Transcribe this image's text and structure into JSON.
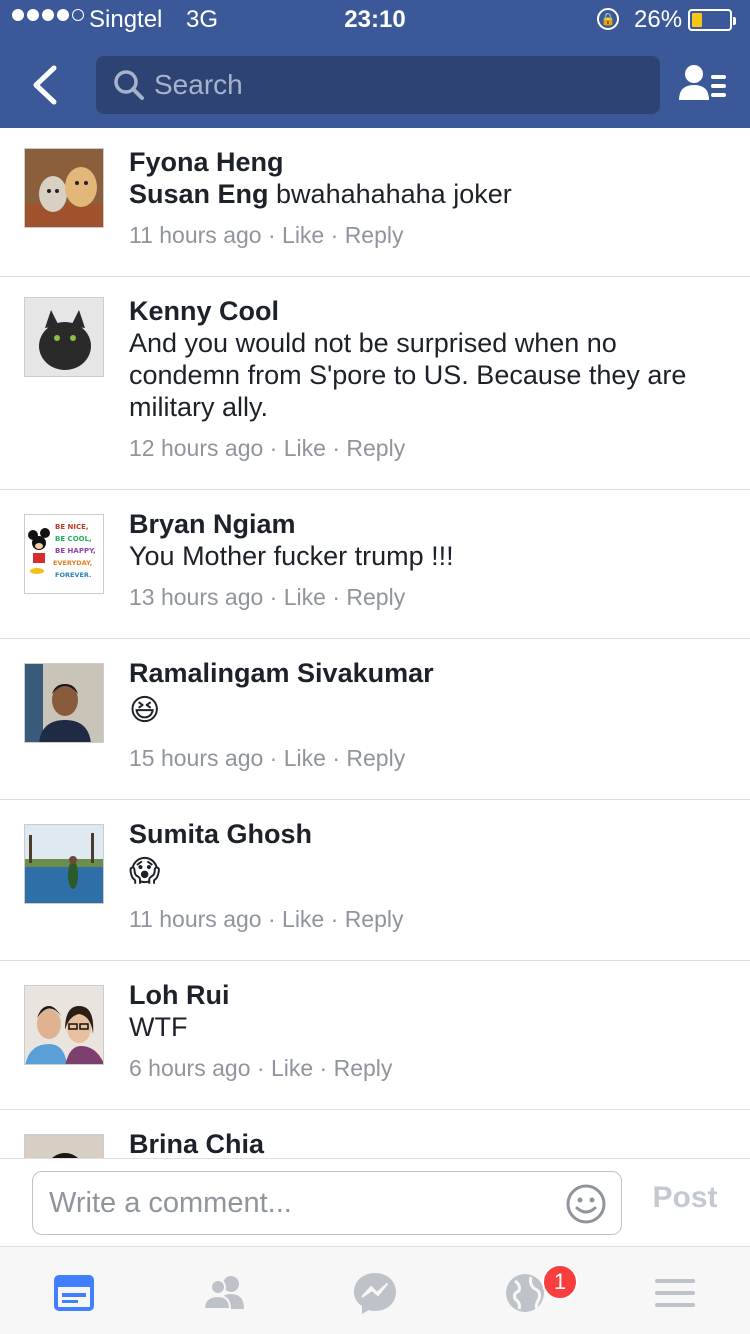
{
  "status_bar": {
    "carrier": "Singtel",
    "network": "3G",
    "time": "23:10",
    "battery_percent": "26%",
    "signal_bars_filled": 4,
    "signal_bars_total": 5
  },
  "nav": {
    "search_placeholder": "Search"
  },
  "comments": [
    {
      "name": "Fyona Heng",
      "tag": "Susan Eng",
      "text": " bwahahahaha joker",
      "time": "11 hours ago",
      "like": "Like",
      "reply": "Reply"
    },
    {
      "name": "Kenny Cool",
      "text": "And you would not be surprised when no condemn from S'pore to US. Because they are military ally.",
      "time": "12 hours ago",
      "like": "Like",
      "reply": "Reply"
    },
    {
      "name": "Bryan Ngiam",
      "text": "You Mother fucker trump !!!",
      "time": "13 hours ago",
      "like": "Like",
      "reply": "Reply",
      "avatar_text": [
        "BE NICE,",
        "BE COOL,",
        "BE HAPPY,",
        "EVERYDAY,",
        "FOREVER."
      ]
    },
    {
      "name": "Ramalingam Sivakumar",
      "emoji": "😆",
      "time": "15 hours ago",
      "like": "Like",
      "reply": "Reply"
    },
    {
      "name": "Sumita Ghosh",
      "emoji": "😱",
      "time": "11 hours ago",
      "like": "Like",
      "reply": "Reply"
    },
    {
      "name": "Loh Rui",
      "text": "WTF",
      "time": "6 hours ago",
      "like": "Like",
      "reply": "Reply"
    },
    {
      "name": "Brina Chia"
    }
  ],
  "composer": {
    "placeholder": "Write a comment...",
    "post_label": "Post"
  },
  "tabbar": {
    "notifications_badge": "1"
  },
  "colors": {
    "facebook_blue": "#3b5998",
    "search_bg": "#2d4373",
    "meta_gray": "#90949c",
    "badge_red": "#fa3e3e",
    "active_tab": "#4080ff",
    "inactive_tab": "#bec2c9"
  },
  "icons": {
    "back": "chevron-left-icon",
    "search": "search-icon",
    "friends": "friend-list-icon",
    "smile": "smiley-icon",
    "tabs": [
      "news-feed-icon",
      "friend-requests-icon",
      "messenger-icon",
      "globe-notifications-icon",
      "menu-icon"
    ]
  }
}
